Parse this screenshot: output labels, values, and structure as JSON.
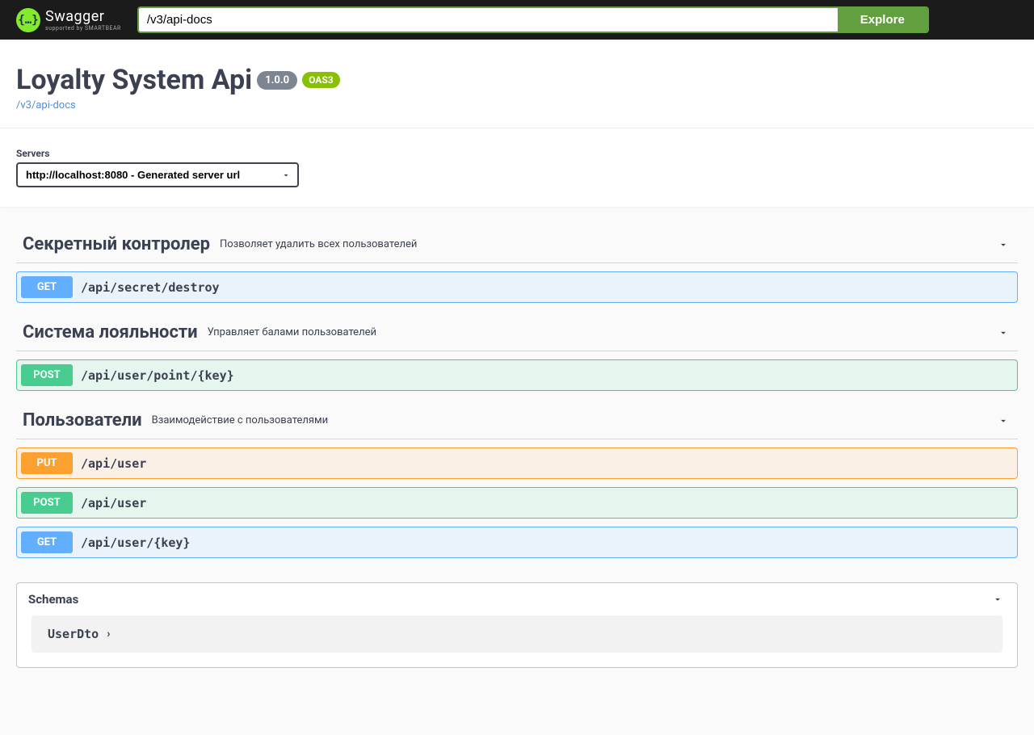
{
  "topbar": {
    "logo_main": "Swagger",
    "logo_sub": "supported by SMARTBEAR",
    "url_value": "/v3/api-docs",
    "explore_label": "Explore"
  },
  "info": {
    "title": "Loyalty System Api",
    "version": "1.0.0",
    "oas": "OAS3",
    "url": "/v3/api-docs"
  },
  "servers": {
    "label": "Servers",
    "selected": "http://localhost:8080 - Generated server url"
  },
  "tags": [
    {
      "name": "Секретный контролер",
      "description": "Позволяет удалить всех пользователей",
      "operations": [
        {
          "method": "GET",
          "path": "/api/secret/destroy",
          "css": "get"
        }
      ]
    },
    {
      "name": "Система лояльности",
      "description": "Управляет балами пользователей",
      "operations": [
        {
          "method": "POST",
          "path": "/api/user/point/{key}",
          "css": "post"
        }
      ]
    },
    {
      "name": "Пользователи",
      "description": "Взаимодействие с пользователями",
      "operations": [
        {
          "method": "PUT",
          "path": "/api/user",
          "css": "put"
        },
        {
          "method": "POST",
          "path": "/api/user",
          "css": "post"
        },
        {
          "method": "GET",
          "path": "/api/user/{key}",
          "css": "get"
        }
      ]
    }
  ],
  "schemas": {
    "title": "Schemas",
    "items": [
      {
        "name": "UserDto"
      }
    ]
  }
}
